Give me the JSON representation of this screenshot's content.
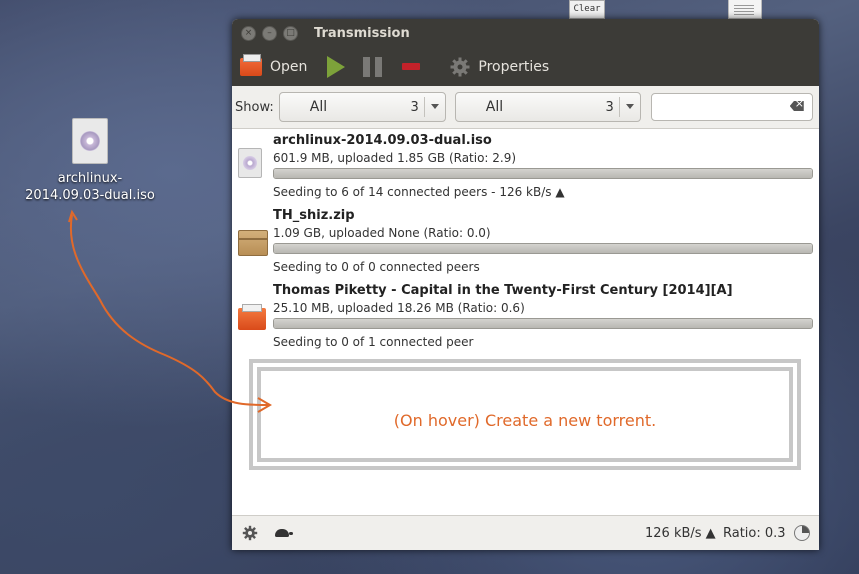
{
  "desktop": {
    "icon_label": "archlinux-2014.09.03-dual.iso",
    "clear_chip": "Clear"
  },
  "window": {
    "title": "Transmission",
    "toolbar": {
      "open_label": "Open",
      "properties_label": "Properties"
    },
    "filter": {
      "show_label": "Show:",
      "combo1": {
        "label": "All",
        "count": "3"
      },
      "combo2": {
        "label": "All",
        "count": "3"
      },
      "search_value": ""
    },
    "torrents": [
      {
        "name": "archlinux-2014.09.03-dual.iso",
        "stats": "601.9 MB, uploaded 1.85 GB (Ratio: 2.9)",
        "status": "Seeding to 6 of 14 connected peers - 126 kB/s ▲",
        "progress": 1.0,
        "icon": "disc-image-icon"
      },
      {
        "name": "TH_shiz.zip",
        "stats": "1.09 GB, uploaded None (Ratio: 0.0)",
        "status": "Seeding to 0 of 0 connected peers",
        "progress": 1.0,
        "icon": "archive-box-icon"
      },
      {
        "name": "Thomas Piketty - Capital in the Twenty-First Century [2014][A]",
        "stats": "25.10 MB, uploaded 18.26 MB (Ratio: 0.6)",
        "status": "Seeding to 0 of 1 connected peer",
        "progress": 1.0,
        "icon": "folder-icon"
      }
    ],
    "drop_hint": "(On hover) Create a new torrent.",
    "statusbar": {
      "speed": "126 kB/s ▲",
      "ratio": "Ratio: 0.3"
    }
  },
  "colors": {
    "annotation": "#e0692a",
    "titlebar": "#3c3b37",
    "play": "#7da23a",
    "remove": "#c3222a"
  }
}
